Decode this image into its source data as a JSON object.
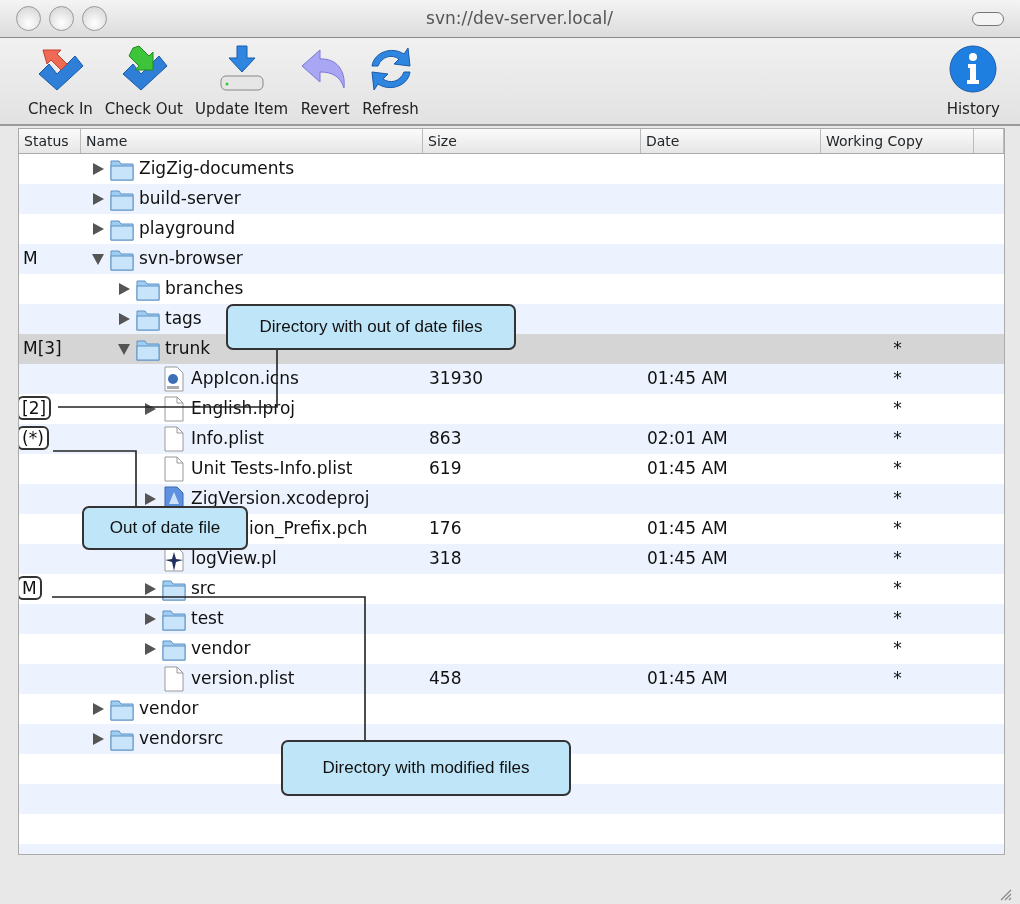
{
  "window": {
    "title": "svn://dev-server.local/"
  },
  "toolbar": {
    "buttons": [
      {
        "label": "Check In",
        "kind": "checkin"
      },
      {
        "label": "Check Out",
        "kind": "checkout"
      },
      {
        "label": "Update Item",
        "kind": "update"
      },
      {
        "label": "Revert",
        "kind": "revert"
      },
      {
        "label": "Refresh",
        "kind": "refresh"
      }
    ],
    "right_buttons": [
      {
        "label": "History",
        "kind": "info"
      }
    ]
  },
  "table": {
    "columns": [
      "Status",
      "Name",
      "Size",
      "Date",
      "Working Copy"
    ],
    "rows": [
      {
        "name": "ZigZig-documents",
        "kind": "folder",
        "expanded": false,
        "selected": false
      },
      {
        "name": "build-server",
        "kind": "folder",
        "expanded": false,
        "selected": false
      },
      {
        "name": "playground",
        "kind": "folder",
        "expanded": false,
        "selected": false
      },
      {
        "name": "svn-browser",
        "kind": "folder",
        "expanded": true,
        "selected": false,
        "status": {
          "text": "M",
          "boxed": false
        },
        "children": [
          {
            "name": "branches",
            "kind": "folder",
            "expanded": false,
            "selected": false
          },
          {
            "name": "tags",
            "kind": "folder",
            "expanded": false,
            "selected": false
          },
          {
            "name": "trunk",
            "kind": "folder",
            "expanded": true,
            "selected": true,
            "status": {
              "text": "M[3]",
              "boxed": false
            },
            "working_copy": "*",
            "children": [
              {
                "name": "AppIcon.icns",
                "kind": "icns",
                "selected": false,
                "size": "31930",
                "date": "01:45 AM",
                "working_copy": "*"
              },
              {
                "name": "English.lproj",
                "kind": "file",
                "expanded": false,
                "selected": false,
                "status": {
                  "text": "[2]",
                  "boxed": true
                },
                "working_copy": "*"
              },
              {
                "name": "Info.plist",
                "kind": "file",
                "selected": false,
                "status": {
                  "text": "(*)",
                  "boxed": true
                },
                "size": "863",
                "date": "02:01 AM",
                "working_copy": "*"
              },
              {
                "name": "Unit Tests-Info.plist",
                "kind": "file",
                "selected": false,
                "size": "619",
                "date": "01:45 AM",
                "working_copy": "*"
              },
              {
                "name": "ZigVersion.xcodeproj",
                "kind": "xcodeproj",
                "expanded": false,
                "selected": false,
                "working_copy": "*"
              },
              {
                "name": "ion_Prefix.pch",
                "selected": false,
                "size": "176",
                "date": "01:45 AM",
                "working_copy": "*"
              },
              {
                "name": "logView.pl",
                "kind": "script",
                "selected": false,
                "size": "318",
                "date": "01:45 AM",
                "working_copy": "*"
              },
              {
                "name": "src",
                "kind": "folder",
                "expanded": false,
                "selected": false,
                "status": {
                  "text": "M",
                  "boxed": true
                },
                "working_copy": "*"
              },
              {
                "name": "test",
                "kind": "folder",
                "expanded": false,
                "selected": false,
                "working_copy": "*"
              },
              {
                "name": "vendor",
                "kind": "folder",
                "expanded": false,
                "selected": false,
                "working_copy": "*"
              },
              {
                "name": "version.plist",
                "kind": "file",
                "selected": false,
                "size": "458",
                "date": "01:45 AM",
                "working_copy": "*"
              }
            ]
          }
        ]
      },
      {
        "name": "vendor",
        "kind": "folder",
        "expanded": false,
        "selected": false
      },
      {
        "name": "vendorsrc",
        "kind": "folder",
        "expanded": false,
        "selected": false
      }
    ]
  },
  "callouts": [
    {
      "text": "Directory with out of date files"
    },
    {
      "text": "Out of date file"
    },
    {
      "text": "Directory with modified files"
    }
  ]
}
